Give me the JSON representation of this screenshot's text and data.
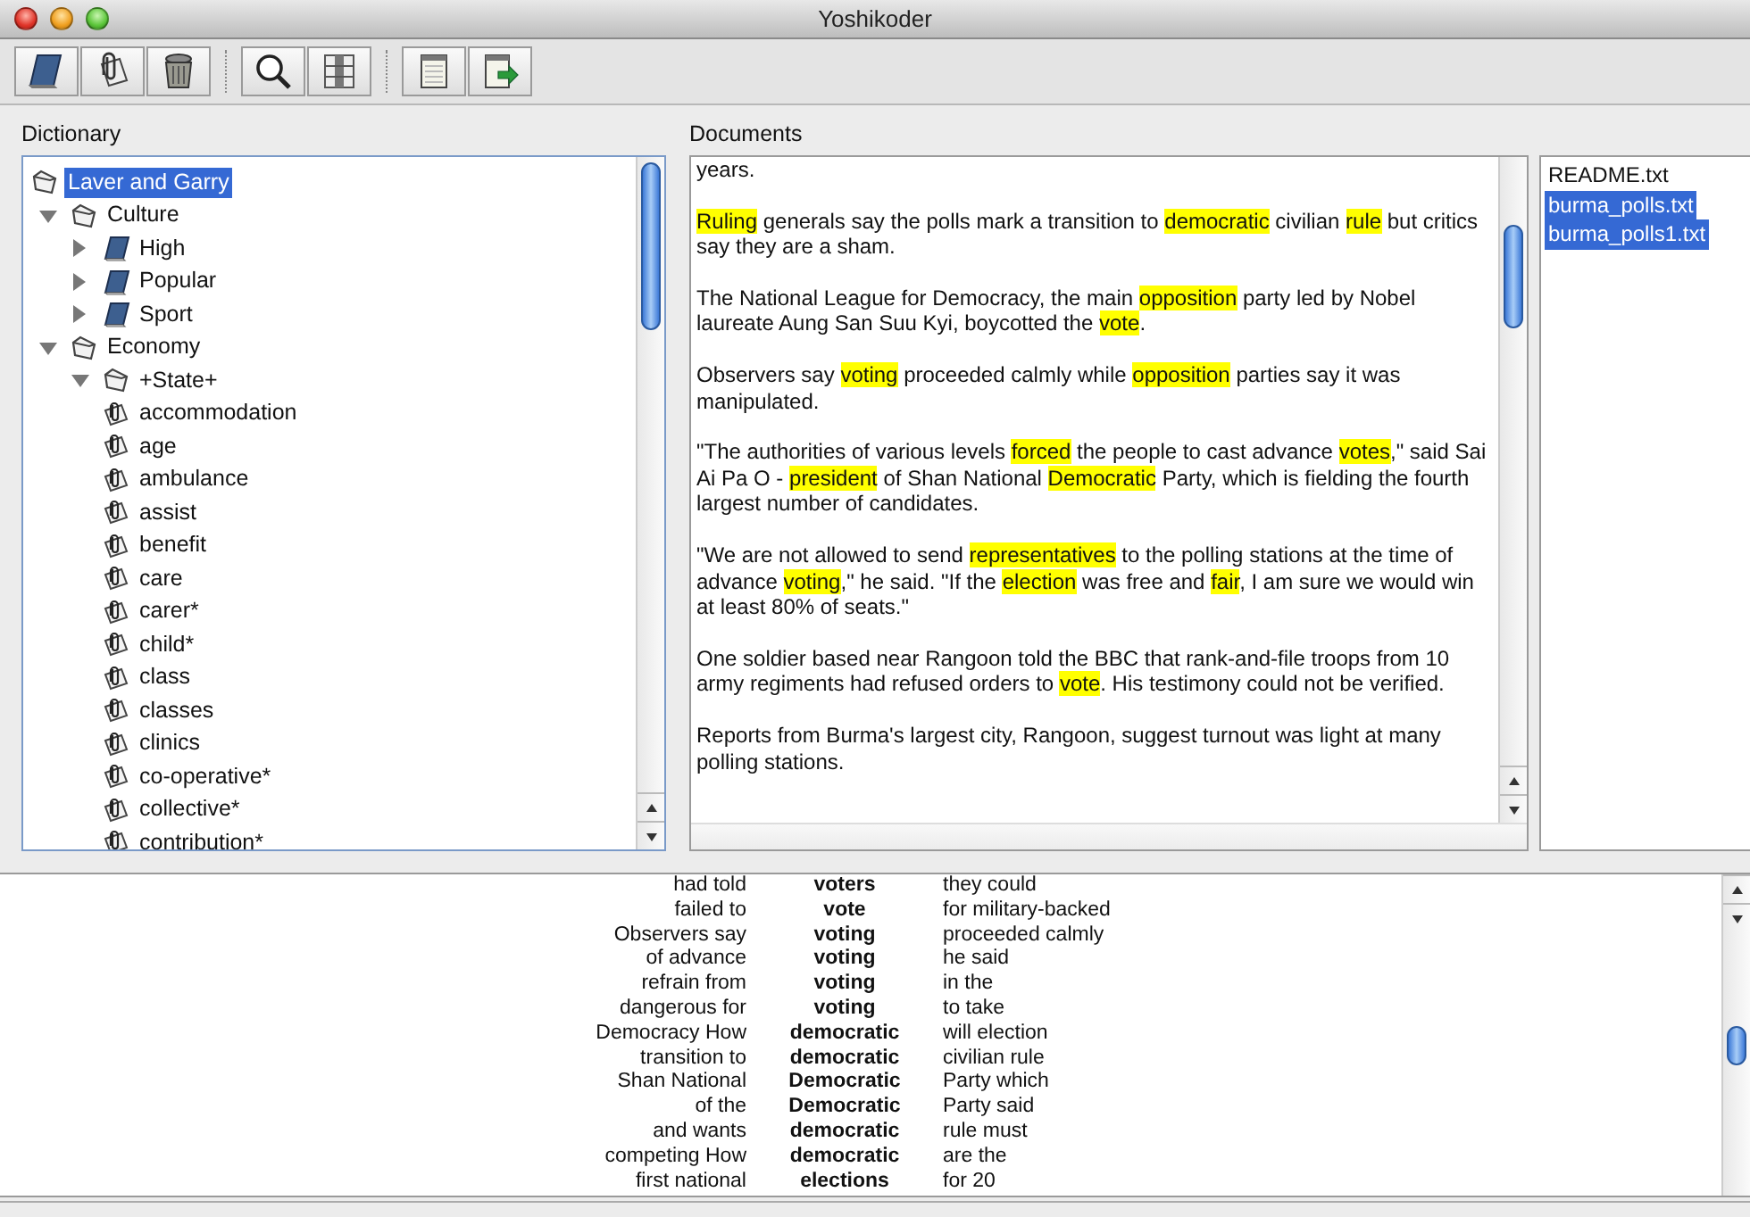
{
  "window": {
    "title": "Yoshikoder"
  },
  "dictionary": {
    "label": "Dictionary",
    "tree": [
      {
        "label": "Laver and Garry",
        "kind": "category",
        "selected": true,
        "children": [
          {
            "label": "Culture",
            "kind": "category",
            "selected": false,
            "expanded": true,
            "children": [
              {
                "label": "High",
                "kind": "dictionary",
                "selected": false,
                "expanded": false
              },
              {
                "label": "Popular",
                "kind": "dictionary",
                "selected": false,
                "expanded": false
              },
              {
                "label": "Sport",
                "kind": "dictionary",
                "selected": false,
                "expanded": false
              }
            ]
          },
          {
            "label": "Economy",
            "kind": "category",
            "selected": false,
            "expanded": true,
            "children": [
              {
                "label": "+State+",
                "kind": "category",
                "selected": false,
                "expanded": true,
                "children": [
                  {
                    "label": "accommodation",
                    "kind": "pattern",
                    "selected": false
                  },
                  {
                    "label": "age",
                    "kind": "pattern",
                    "selected": false
                  },
                  {
                    "label": "ambulance",
                    "kind": "pattern",
                    "selected": false
                  },
                  {
                    "label": "assist",
                    "kind": "pattern",
                    "selected": false
                  },
                  {
                    "label": "benefit",
                    "kind": "pattern",
                    "selected": false
                  },
                  {
                    "label": "care",
                    "kind": "pattern",
                    "selected": false
                  },
                  {
                    "label": "carer*",
                    "kind": "pattern",
                    "selected": false
                  },
                  {
                    "label": "child*",
                    "kind": "pattern",
                    "selected": false
                  },
                  {
                    "label": "class",
                    "kind": "pattern",
                    "selected": false
                  },
                  {
                    "label": "classes",
                    "kind": "pattern",
                    "selected": false
                  },
                  {
                    "label": "clinics",
                    "kind": "pattern",
                    "selected": false
                  },
                  {
                    "label": "co-operative*",
                    "kind": "pattern",
                    "selected": false
                  },
                  {
                    "label": "collective*",
                    "kind": "pattern",
                    "selected": false
                  },
                  {
                    "label": "contribution*",
                    "kind": "pattern",
                    "selected": false
                  }
                ]
              }
            ]
          }
        ]
      }
    ]
  },
  "documents": {
    "label": "Documents",
    "paragraphs": [
      [
        {
          "text": "years.",
          "highlighted": false
        }
      ],
      [
        {
          "text": "Ruling",
          "highlighted": true
        },
        {
          "text": " generals say the polls mark a transition to ",
          "highlighted": false
        },
        {
          "text": "democratic",
          "highlighted": true
        },
        {
          "text": " civilian ",
          "highlighted": false
        },
        {
          "text": "rule",
          "highlighted": true
        },
        {
          "text": " but critics say they are a sham.",
          "highlighted": false
        }
      ],
      [
        {
          "text": "The National League for Democracy, the main ",
          "highlighted": false
        },
        {
          "text": "opposition",
          "highlighted": true
        },
        {
          "text": " party led by Nobel laureate Aung San Suu Kyi, boycotted the ",
          "highlighted": false
        },
        {
          "text": "vote",
          "highlighted": true
        },
        {
          "text": ".",
          "highlighted": false
        }
      ],
      [
        {
          "text": "Observers say ",
          "highlighted": false
        },
        {
          "text": "voting",
          "highlighted": true
        },
        {
          "text": " proceeded calmly while ",
          "highlighted": false
        },
        {
          "text": "opposition",
          "highlighted": true
        },
        {
          "text": " parties say it was manipulated.",
          "highlighted": false
        }
      ],
      [
        {
          "text": "\"The authorities of various levels ",
          "highlighted": false
        },
        {
          "text": "forced",
          "highlighted": true
        },
        {
          "text": " the people to cast advance ",
          "highlighted": false
        },
        {
          "text": "votes",
          "highlighted": true
        },
        {
          "text": ",\" said Sai Ai Pa O - ",
          "highlighted": false
        },
        {
          "text": "president",
          "highlighted": true
        },
        {
          "text": " of Shan National ",
          "highlighted": false
        },
        {
          "text": "Democratic",
          "highlighted": true
        },
        {
          "text": " Party, which is fielding the fourth largest number of candidates.",
          "highlighted": false
        }
      ],
      [
        {
          "text": "\"We are not allowed to send ",
          "highlighted": false
        },
        {
          "text": "representatives",
          "highlighted": true
        },
        {
          "text": " to the polling stations at the time of advance ",
          "highlighted": false
        },
        {
          "text": "voting",
          "highlighted": true
        },
        {
          "text": ",\" he said. \"If the ",
          "highlighted": false
        },
        {
          "text": "election",
          "highlighted": true
        },
        {
          "text": " was free and ",
          "highlighted": false
        },
        {
          "text": "fair",
          "highlighted": true
        },
        {
          "text": ", I am sure we would win at least 80% of seats.\"",
          "highlighted": false
        }
      ],
      [
        {
          "text": "One soldier based near Rangoon told the BBC that rank-and-file troops from 10 army regiments had refused orders to ",
          "highlighted": false
        },
        {
          "text": "vote",
          "highlighted": true
        },
        {
          "text": ". His testimony could not be verified.",
          "highlighted": false
        }
      ],
      [
        {
          "text": "Reports from Burma's largest city, Rangoon, suggest turnout was light at many polling stations.",
          "highlighted": false
        }
      ]
    ],
    "files": [
      {
        "name": "README.txt",
        "selected": false
      },
      {
        "name": "burma_polls.txt",
        "selected": true
      },
      {
        "name": "burma_polls1.txt",
        "selected": true
      }
    ]
  },
  "concordance": {
    "rows": [
      {
        "left": "had told",
        "keyword": "voters",
        "right": "they could"
      },
      {
        "left": "failed to",
        "keyword": "vote",
        "right": "for military-backed"
      },
      {
        "left": "Observers say",
        "keyword": "voting",
        "right": "proceeded calmly"
      },
      {
        "left": "of advance",
        "keyword": "voting",
        "right": "he said"
      },
      {
        "left": "refrain from",
        "keyword": "voting",
        "right": "in the"
      },
      {
        "left": "dangerous for",
        "keyword": "voting",
        "right": "to take"
      },
      {
        "left": "Democracy How",
        "keyword": "democratic",
        "right": "will election"
      },
      {
        "left": "transition to",
        "keyword": "democratic",
        "right": "civilian rule"
      },
      {
        "left": "Shan National",
        "keyword": "Democratic",
        "right": "Party which"
      },
      {
        "left": "of the",
        "keyword": "Democratic",
        "right": "Party said"
      },
      {
        "left": "and wants",
        "keyword": "democratic",
        "right": "rule must"
      },
      {
        "left": "competing How",
        "keyword": "democratic",
        "right": "are the"
      },
      {
        "left": "first national",
        "keyword": "elections",
        "right": "for 20"
      }
    ]
  }
}
